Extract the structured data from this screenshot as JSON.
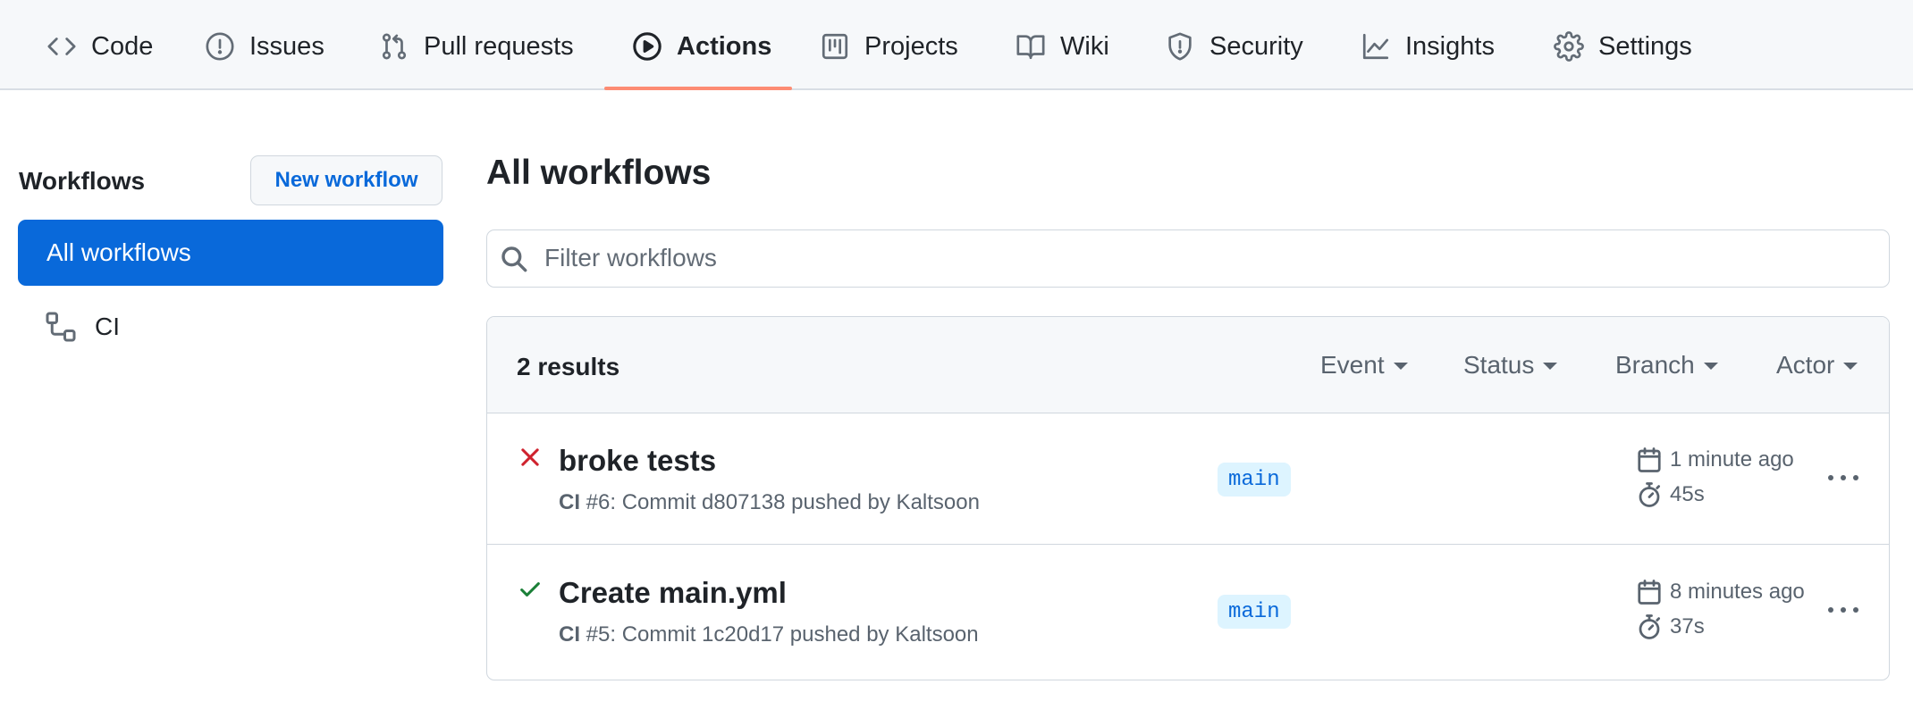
{
  "repo_nav": {
    "tabs": [
      {
        "label": "Code",
        "icon": "code-icon"
      },
      {
        "label": "Issues",
        "icon": "issue-icon"
      },
      {
        "label": "Pull requests",
        "icon": "pull-request-icon"
      },
      {
        "label": "Actions",
        "icon": "play-icon",
        "selected": true
      },
      {
        "label": "Projects",
        "icon": "project-board-icon"
      },
      {
        "label": "Wiki",
        "icon": "book-icon"
      },
      {
        "label": "Security",
        "icon": "shield-icon"
      },
      {
        "label": "Insights",
        "icon": "graph-icon"
      },
      {
        "label": "Settings",
        "icon": "gear-icon"
      }
    ]
  },
  "sidebar": {
    "title": "Workflows",
    "new_workflow_label": "New workflow",
    "items": [
      {
        "label": "All workflows",
        "active": true
      },
      {
        "label": "CI",
        "icon": "workflow-icon"
      }
    ]
  },
  "main": {
    "title": "All workflows",
    "search": {
      "placeholder": "Filter workflows",
      "value": ""
    },
    "results_label": "2 results",
    "filters": [
      "Event",
      "Status",
      "Branch",
      "Actor"
    ],
    "runs": [
      {
        "status": "failure",
        "title": "broke tests",
        "workflow": "CI",
        "meta": " #6: Commit d807138 pushed by Kaltsoon",
        "branch": "main",
        "time_ago": "1 minute ago",
        "duration": "45s"
      },
      {
        "status": "success",
        "title": "Create main.yml",
        "workflow": "CI",
        "meta": " #5: Commit 1c20d17 pushed by Kaltsoon",
        "branch": "main",
        "time_ago": "8 minutes ago",
        "duration": "37s"
      }
    ]
  },
  "colors": {
    "accent": "#0969da",
    "selected_tab_underline": "#fd8c73",
    "failure": "#cf222e",
    "success": "#1a7f37",
    "branch_bg": "#ddf4ff"
  }
}
